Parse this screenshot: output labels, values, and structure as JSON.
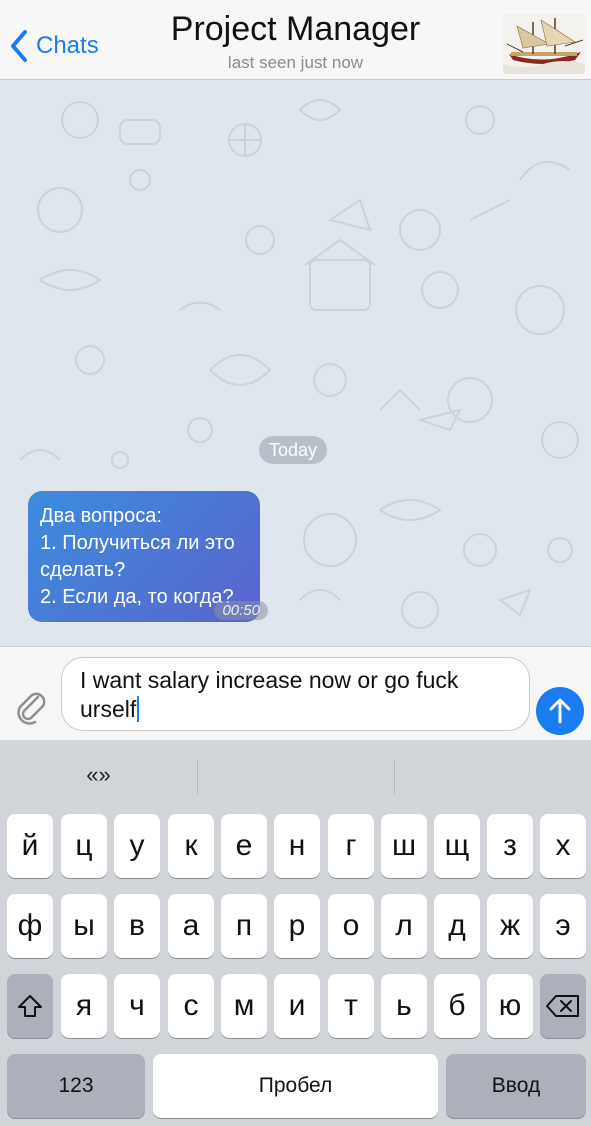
{
  "header": {
    "back_label": "Chats",
    "title": "Project Manager",
    "status": "last seen just now"
  },
  "chat": {
    "date_label": "Today",
    "messages": [
      {
        "lines": [
          "Два вопроса:",
          "1. Получиться ли это",
          "сделать?",
          "2. Если да, то когда?"
        ],
        "time": "00:50"
      }
    ]
  },
  "composer": {
    "text_line1": "I want salary increase now or go fuck",
    "text_line2": "urself"
  },
  "keyboard": {
    "suggestions": [
      "«»",
      "",
      ""
    ],
    "row1": [
      "й",
      "ц",
      "у",
      "к",
      "е",
      "н",
      "г",
      "ш",
      "щ",
      "з",
      "х"
    ],
    "row2": [
      "ф",
      "ы",
      "в",
      "а",
      "п",
      "р",
      "о",
      "л",
      "д",
      "ж",
      "э"
    ],
    "row3": [
      "я",
      "ч",
      "с",
      "м",
      "и",
      "т",
      "ь",
      "б",
      "ю"
    ],
    "numbers_label": "123",
    "space_label": "Пробел",
    "return_label": "Ввод"
  },
  "colors": {
    "accent": "#1a7cf2",
    "bubble": "#4a7fd8",
    "keyboard_bg": "#d1d4d9"
  }
}
